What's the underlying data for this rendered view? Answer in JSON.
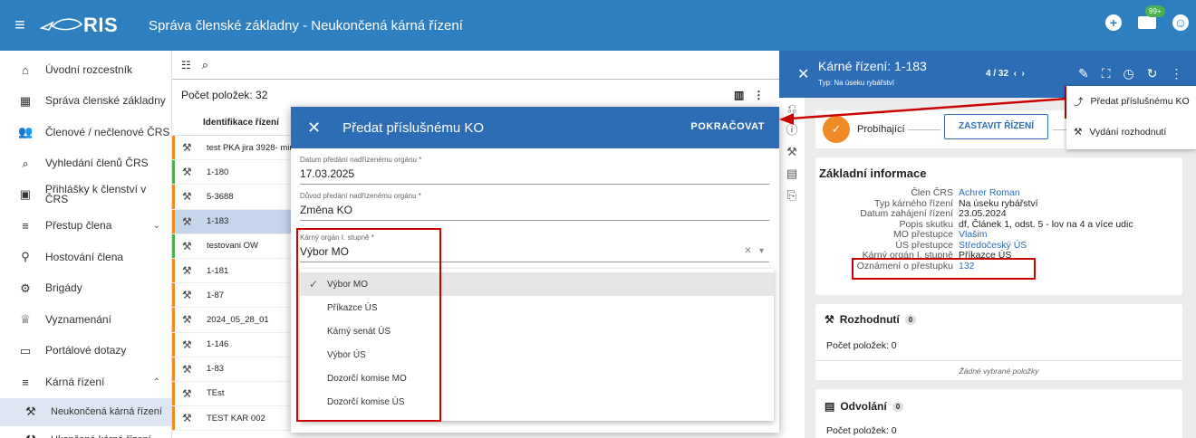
{
  "header": {
    "logo_text": "RIS",
    "title": "Správa členské základny - Neukončená kárná řízení",
    "notif_badge": "99+"
  },
  "sidebar": {
    "items": [
      {
        "icon": "home-icon",
        "label": "Úvodní rozcestník"
      },
      {
        "icon": "grid-icon",
        "label": "Správa členské základny"
      },
      {
        "icon": "people-icon",
        "label": "Členové / nečlenové ČRS"
      },
      {
        "icon": "search-icon",
        "label": "Vyhledání členů ČRS"
      },
      {
        "icon": "member-card-icon",
        "label": "Přihlášky k členství v ČRS"
      },
      {
        "icon": "list-icon",
        "label": "Přestup člena",
        "chev": "⌄"
      },
      {
        "icon": "guest-icon",
        "label": "Hostování člena"
      },
      {
        "icon": "bike-icon",
        "label": "Brigády"
      },
      {
        "icon": "trophy-icon",
        "label": "Vyznamenání"
      },
      {
        "icon": "chat-icon",
        "label": "Portálové dotazy"
      },
      {
        "icon": "list-icon",
        "label": "Kárná řízení",
        "chev": "⌃"
      }
    ],
    "sub_items": [
      {
        "icon": "gavel-x-icon",
        "label": "Neukončená kárná řízení"
      },
      {
        "icon": "gavel-check-icon",
        "label": "Ukončená kárná řízení"
      }
    ]
  },
  "list": {
    "count_label": "Počet položek: 32",
    "column_header": "Identifikace řízení",
    "rows": [
      {
        "id": "test PKA jira 3928- mimo",
        "color": "#f08a24"
      },
      {
        "id": "1-180",
        "color": "#4caf50"
      },
      {
        "id": "5-3688",
        "color": "#f08a24"
      },
      {
        "id": "1-183",
        "color": "#f08a24",
        "selected": true
      },
      {
        "id": "testovani OW",
        "color": "#4caf50"
      },
      {
        "id": "1-181",
        "color": "#f08a24"
      },
      {
        "id": "1-87",
        "color": "#f08a24"
      },
      {
        "id": "2024_05_28_01",
        "color": "#f08a24"
      },
      {
        "id": "1-146",
        "color": "#f08a24"
      },
      {
        "id": "1-83",
        "color": "#f08a24"
      },
      {
        "id": "TEst",
        "color": "#f08a24"
      },
      {
        "id": "TEST KAR 002",
        "color": "#f08a24"
      }
    ]
  },
  "dialog": {
    "title": "Předat příslušnému KO",
    "continue": "POKRAČOVAT",
    "date_label": "Datum předání nadřízenému orgánu *",
    "date_value": "17.03.2025",
    "reason_label": "Důvod předání nadřízenému orgánu *",
    "reason_value": "Změna KO",
    "organ_label": "Kárný orgán I. stupně *",
    "organ_value": "Výbor MO",
    "options": [
      "Výbor MO",
      "Příkazce ÚS",
      "Kárný senát ÚS",
      "Výbor ÚS",
      "Dozorčí komise MO",
      "Dozorčí komise ÚS"
    ]
  },
  "detail": {
    "title": "Kárné řízení: 1-183",
    "subtitle": "Typ: Na úseku rybářství",
    "pager": "4 / 32",
    "status": "Probíhající",
    "stop_button": "ZASTAVIT ŘÍZENÍ",
    "basic_info_title": "Základní informace",
    "info": [
      {
        "k": "Člen ČRS",
        "v": "Achrer Roman",
        "link": true
      },
      {
        "k": "Typ kárného řízení",
        "v": "Na úseku rybářství"
      },
      {
        "k": "Datum zahájení řízení",
        "v": "23.05.2024"
      },
      {
        "k": "Popis skutku",
        "v": "df, Článek 1, odst. 5 - lov na 4 a více udic"
      },
      {
        "k": "MO přestupce",
        "v": "Vlašim",
        "link": true
      },
      {
        "k": "ÚS přestupce",
        "v": "Středočeský ÚS",
        "link": true
      },
      {
        "k": "Kárný orgán I. stupně",
        "v": "Příkazce ÚS"
      },
      {
        "k": "Oznámení o přestupku",
        "v": "132",
        "link": true
      }
    ],
    "decisions": {
      "title": "Rozhodnutí",
      "count": "0",
      "items_label": "Počet položek: 0",
      "empty": "Žádné vybrané položky"
    },
    "appeals": {
      "title": "Odvolání",
      "count": "0",
      "items_label": "Počet položek: 0"
    }
  },
  "context_menu": {
    "items": [
      "Předat příslušnému KO",
      "Vydání rozhodnutí"
    ]
  },
  "colors": {
    "primary": "#2d6db5",
    "topbar": "#2e7fbf",
    "orange": "#f08a24",
    "green": "#4caf50",
    "highlight": "#c00000"
  }
}
